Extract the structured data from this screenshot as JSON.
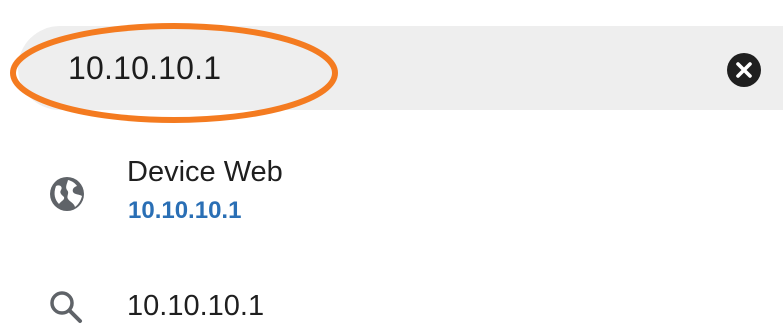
{
  "search": {
    "value": "10.10.10.1",
    "clear_icon": "close-circle-icon"
  },
  "annotation": {
    "highlight_color": "#f47b20"
  },
  "suggestions": [
    {
      "icon": "globe-icon",
      "title": "Device Web",
      "url": "10.10.10.1"
    },
    {
      "icon": "search-icon",
      "query": "10.10.10.1"
    }
  ],
  "colors": {
    "bar_bg": "#eeeeee",
    "link": "#2a6fb5",
    "text": "#1f1f1f",
    "icon": "#5f6368"
  }
}
